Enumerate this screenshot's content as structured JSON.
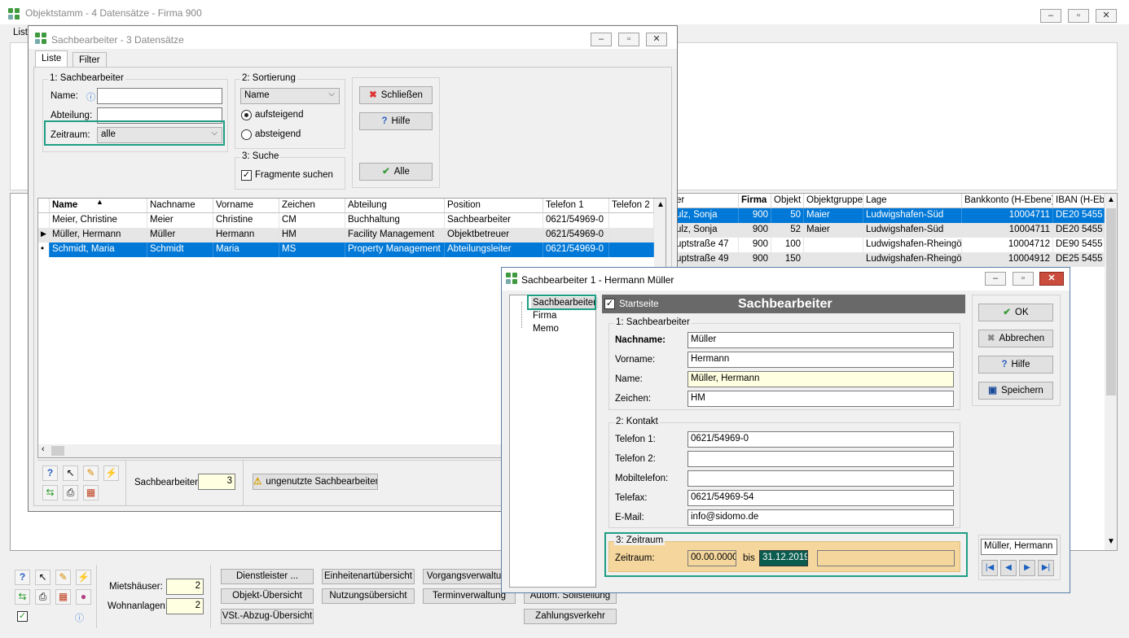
{
  "main": {
    "title": "Objektstamm - 4 Datensätze - Firma 900",
    "tab_liste": "Liste",
    "header_cols": [
      "er",
      "Firma",
      "Objekt",
      "Objektgruppe",
      "Lage",
      "Bankkonto (H-Ebene)",
      "IBAN (H-Ebe"
    ],
    "rows": [
      [
        "ulz, Sonja",
        "900",
        "50",
        "Maier",
        "Ludwigshafen-Süd",
        "10004711",
        "DE20 5455"
      ],
      [
        "ulz, Sonja",
        "900",
        "52",
        "Maier",
        "Ludwigshafen-Süd",
        "10004711",
        "DE20 5455"
      ],
      [
        "uptstraße 47",
        "900",
        "100",
        "",
        "Ludwigshafen-Rheingönl",
        "10004712",
        "DE90 5455"
      ],
      [
        "uptstraße 49",
        "900",
        "150",
        "",
        "Ludwigshafen-Rheingönl",
        "10004912",
        "DE25 5455"
      ]
    ],
    "mietshaeuser_label": "Mietshäuser:",
    "mietshaeuser_value": "2",
    "wohnanlagen_label": "Wohnanlagen:",
    "wohnanlagen_value": "2",
    "buttons": {
      "dienstleister": "Dienstleister ...",
      "objekt_uebersicht": "Objekt-Übersicht",
      "vst": "VSt.-Abzug-Übersicht",
      "einheitenart": "Einheitenartübersicht",
      "nutzung": "Nutzungsübersicht",
      "vorgang": "Vorgangsverwaltung",
      "termin": "Terminverwaltung",
      "soll": "Autom. Sollstellung",
      "zahlung": "Zahlungsverkehr"
    }
  },
  "sb_list": {
    "title": "Sachbearbeiter - 3 Datensätze",
    "tabs": [
      "Liste",
      "Filter"
    ],
    "group1_caption": "1: Sachbearbeiter",
    "name_label": "Name:",
    "abteilung_label": "Abteilung:",
    "zeitraum_label": "Zeitraum:",
    "zeitraum_value": "alle",
    "name_value": "",
    "abteilung_value": "",
    "group2_caption": "2: Sortierung",
    "sort_value": "Name",
    "asc_label": "aufsteigend",
    "desc_label": "absteigend",
    "group3_caption": "3: Suche",
    "fragmente_label": "Fragmente suchen",
    "btn_schliessen": "Schließen",
    "btn_hilfe": "Hilfe",
    "btn_alle": "Alle",
    "columns": [
      "Name",
      "Nachname",
      "Vorname",
      "Zeichen",
      "Abteilung",
      "Position",
      "Telefon 1",
      "Telefon 2"
    ],
    "rows": [
      [
        "Meier, Christine",
        "Meier",
        "Christine",
        "CM",
        "Buchhaltung",
        "Sachbearbeiter",
        "0621/54969-0",
        ""
      ],
      [
        "Müller, Hermann",
        "Müller",
        "Hermann",
        "HM",
        "Facility Management",
        "Objektbetreuer",
        "0621/54969-0",
        ""
      ],
      [
        "Schmidt, Maria",
        "Schmidt",
        "Maria",
        "MS",
        "Property Management",
        "Abteilungsleiter",
        "0621/54969-0",
        ""
      ]
    ],
    "count_label": "Sachbearbeiter:",
    "count_value": "3",
    "unused_btn": "ungenutzte Sachbearbeiter"
  },
  "sb_detail": {
    "title": "Sachbearbeiter 1 - Hermann Müller",
    "tree": [
      "Sachbearbeiter",
      "Firma",
      "Memo"
    ],
    "startseite_label": "Startseite",
    "header_title": "Sachbearbeiter",
    "group1_caption": "1: Sachbearbeiter",
    "nachname_label": "Nachname:",
    "nachname_value": "Müller",
    "vorname_label": "Vorname:",
    "vorname_value": "Hermann",
    "name_label": "Name:",
    "name_value": "Müller, Hermann",
    "zeichen_label": "Zeichen:",
    "zeichen_value": "HM",
    "group2_caption": "2: Kontakt",
    "tel1_label": "Telefon 1:",
    "tel1_value": "0621/54969-0",
    "tel2_label": "Telefon 2:",
    "tel2_value": "",
    "mobil_label": "Mobiltelefon:",
    "mobil_value": "",
    "fax_label": "Telefax:",
    "fax_value": "0621/54969-54",
    "email_label": "E-Mail:",
    "email_value": "info@sidomo.de",
    "group3_caption": "3: Zeitraum",
    "zeitraum_label": "Zeitraum:",
    "von_value": "00.00.0000",
    "bis_label": "bis",
    "bis_value": "31.12.2019",
    "btn_ok": "OK",
    "btn_abbrechen": "Abbrechen",
    "btn_hilfe": "Hilfe",
    "btn_speichern": "Speichern",
    "nav_name": "Müller, Hermann",
    "colors": {
      "accent": "#1e9e84",
      "header": "#696969",
      "zeitraum_bg": "#f5d79e"
    }
  }
}
